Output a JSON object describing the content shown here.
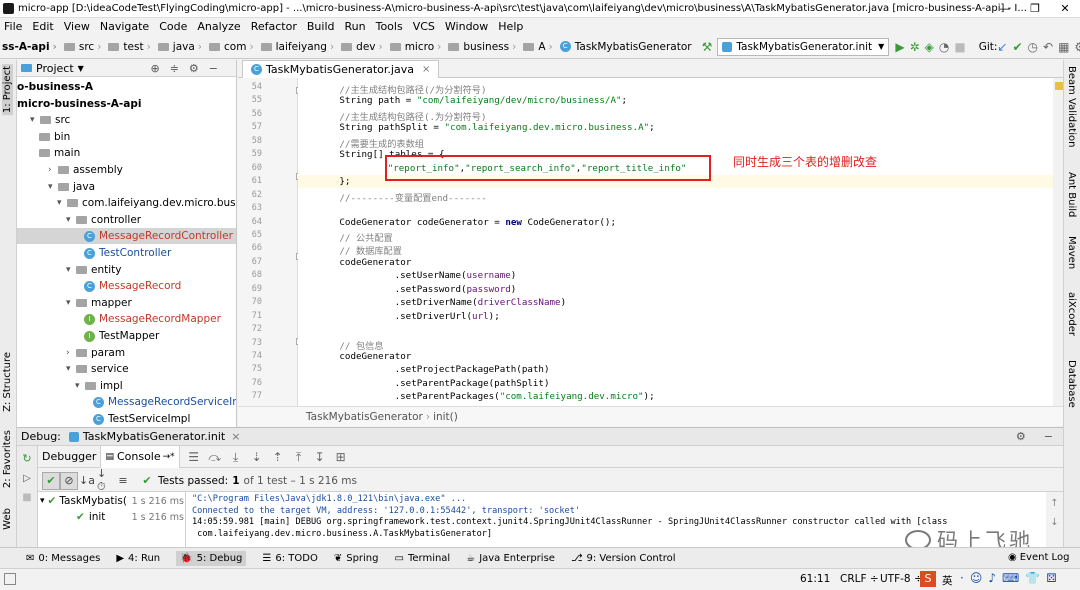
{
  "title_bar": {
    "text": "micro-app [D:\\ideaCodeTest\\FlyingCoding\\micro-app] - ...\\micro-business-A\\micro-business-A-api\\src\\test\\java\\com\\laifeiyang\\dev\\micro\\business\\A\\TaskMybatisGenerator.java [micro-business-A-api] - I..."
  },
  "menu": [
    "File",
    "Edit",
    "View",
    "Navigate",
    "Code",
    "Analyze",
    "Refactor",
    "Build",
    "Run",
    "Tools",
    "VCS",
    "Window",
    "Help"
  ],
  "breadcrumbs": [
    "ss-A-api",
    "src",
    "test",
    "java",
    "com",
    "laifeiyang",
    "dev",
    "micro",
    "business",
    "A",
    "TaskMybatisGenerator"
  ],
  "run_config": "TaskMybatisGenerator.init",
  "git_label": "Git:",
  "project_panel": {
    "title": "Project"
  },
  "tree": [
    {
      "label": "o-business-A",
      "indent": 0,
      "kind": "bold"
    },
    {
      "label": "micro-business-A-api",
      "indent": 0,
      "kind": "bold"
    },
    {
      "label": "src",
      "indent": 1,
      "kind": "folder",
      "arrow": "open"
    },
    {
      "label": "bin",
      "indent": 2,
      "kind": "folder"
    },
    {
      "label": "main",
      "indent": 2,
      "kind": "folder"
    },
    {
      "label": "assembly",
      "indent": 3,
      "kind": "folder",
      "arrow": "closed"
    },
    {
      "label": "java",
      "indent": 3,
      "kind": "folder",
      "arrow": "open"
    },
    {
      "label": "com.laifeiyang.dev.micro.business.A",
      "indent": 4,
      "kind": "folder",
      "arrow": "open"
    },
    {
      "label": "controller",
      "indent": 5,
      "kind": "folder",
      "arrow": "open"
    },
    {
      "label": "MessageRecordController",
      "indent": 7,
      "kind": "class-red"
    },
    {
      "label": "TestController",
      "indent": 7,
      "kind": "class-blue"
    },
    {
      "label": "entity",
      "indent": 5,
      "kind": "folder",
      "arrow": "open"
    },
    {
      "label": "MessageRecord",
      "indent": 7,
      "kind": "class-red"
    },
    {
      "label": "mapper",
      "indent": 5,
      "kind": "folder",
      "arrow": "open"
    },
    {
      "label": "MessageRecordMapper",
      "indent": 7,
      "kind": "intf-red"
    },
    {
      "label": "TestMapper",
      "indent": 7,
      "kind": "intf"
    },
    {
      "label": "param",
      "indent": 5,
      "kind": "folder",
      "arrow": "closed"
    },
    {
      "label": "service",
      "indent": 5,
      "kind": "folder",
      "arrow": "open"
    },
    {
      "label": "impl",
      "indent": 6,
      "kind": "folder",
      "arrow": "open"
    },
    {
      "label": "MessageRecordServiceIm",
      "indent": 8,
      "kind": "class-blue"
    },
    {
      "label": "TestServiceImpl",
      "indent": 8,
      "kind": "class"
    }
  ],
  "editor_tab": "TaskMybatisGenerator.java",
  "code_lines": [
    {
      "n": "54",
      "html": "<span class=\"cm\">//主生成结构包路径(/为分割符号)</span>",
      "ind": 6
    },
    {
      "n": "55",
      "html": "String path = <span class=\"str\">\"com/laifeiyang/dev/micro/business/A\"</span>;",
      "ind": 6
    },
    {
      "n": "56",
      "html": "<span class=\"cm\">//主生成结构包路径(.为分割符号)</span>",
      "ind": 6
    },
    {
      "n": "57",
      "html": "String pathSplit = <span class=\"str\">\"com.laifeiyang.dev.micro.business.A\"</span>;",
      "ind": 6
    },
    {
      "n": "58",
      "html": "<span class=\"cm\">//需要生成的表数组</span>",
      "ind": 6
    },
    {
      "n": "59",
      "html": "String[] tables = {",
      "ind": 6
    },
    {
      "n": "60",
      "html": "<span class=\"str\">\"report_info\"</span>,<span class=\"str\">\"report_search_info\"</span>,<span class=\"str\">\"report_title_info\"</span>",
      "ind": 13
    },
    {
      "n": "61",
      "html": "};",
      "ind": 6
    },
    {
      "n": "62",
      "html": "<span class=\"cm\">//--------变量配置end-------</span>",
      "ind": 6
    },
    {
      "n": "63",
      "html": "",
      "ind": 6
    },
    {
      "n": "64",
      "html": "CodeGenerator codeGenerator = <span class=\"kw\">new</span> CodeGenerator();",
      "ind": 6
    },
    {
      "n": "65",
      "html": "<span class=\"cm\">// 公共配置</span>",
      "ind": 6
    },
    {
      "n": "66",
      "html": "<span class=\"cm\">// 数据库配置</span>",
      "ind": 6
    },
    {
      "n": "67",
      "html": "codeGenerator",
      "ind": 6
    },
    {
      "n": "68",
      "html": ".setUserName(<span class=\"prm\">username</span>)",
      "ind": 14
    },
    {
      "n": "69",
      "html": ".setPassword(<span class=\"prm\">password</span>)",
      "ind": 14
    },
    {
      "n": "70",
      "html": ".setDriverName(<span class=\"prm\">driverClassName</span>)",
      "ind": 14
    },
    {
      "n": "71",
      "html": ".setDriverUrl(<span class=\"prm\">url</span>);",
      "ind": 14
    },
    {
      "n": "72",
      "html": "",
      "ind": 6
    },
    {
      "n": "73",
      "html": "<span class=\"cm\">// 包信息</span>",
      "ind": 6
    },
    {
      "n": "74",
      "html": "codeGenerator",
      "ind": 6
    },
    {
      "n": "75",
      "html": ".setProjectPackagePath(path)",
      "ind": 14
    },
    {
      "n": "76",
      "html": ".setParentPackage(pathSplit)",
      "ind": 14
    },
    {
      "n": "77",
      "html": ".setParentPackages(<span class=\"str\">\"com.laifeiyang.dev.micro\"</span>);",
      "ind": 14
    }
  ],
  "annotation": "同时生成三个表的增删改查",
  "editor_breadcrumb": [
    "TaskMybatisGenerator",
    "init()"
  ],
  "debug": {
    "label": "Debug:",
    "config": "TaskMybatisGenerator.init",
    "tabs": [
      "Debugger",
      "Console"
    ],
    "tests_passed": "Tests passed:",
    "tests_count": "1",
    "tests_detail": "of 1 test – 1 s 216 ms"
  },
  "test_tree": [
    {
      "label": "TaskMybatis(",
      "time": "1 s 216 ms"
    },
    {
      "label": "init",
      "time": "1 s 216 ms"
    }
  ],
  "console_lines": [
    "\"C:\\Program Files\\Java\\jdk1.8.0_121\\bin\\java.exe\" ...",
    "Connected to the target VM, address: '127.0.0.1:55442', transport: 'socket'",
    "14:05:59.981 [main] DEBUG org.springframework.test.context.junit4.SpringJUnit4ClassRunner - SpringJUnit4ClassRunner constructor called with [class",
    " com.laifeiyang.dev.micro.business.A.TaskMybatisGenerator]"
  ],
  "console_colors": [
    "#1a4ea0",
    "#1a4ea0",
    "#000000",
    "#000000"
  ],
  "left_stripe": [
    "1: Project",
    "Z: Structure",
    "2: Favorites",
    "Web"
  ],
  "right_stripe": [
    "Beam Validation",
    "Ant Build",
    "Maven",
    "aiXcoder",
    "Database"
  ],
  "tool_windows": [
    {
      "label": "0: Messages",
      "icon": "✉"
    },
    {
      "label": "4: Run",
      "icon": "▶"
    },
    {
      "label": "5: Debug",
      "icon": "🐞"
    },
    {
      "label": "6: TODO",
      "icon": "☰"
    },
    {
      "label": "Spring",
      "icon": "❦"
    },
    {
      "label": "Terminal",
      "icon": "▭"
    },
    {
      "label": "Java Enterprise",
      "icon": "☕"
    },
    {
      "label": "9: Version Control",
      "icon": "⎇"
    }
  ],
  "event_log": "Event Log",
  "status": {
    "position": "61:11",
    "line_sep": "CRLF ÷",
    "encoding": "UTF-8 ÷",
    "ime": "英"
  },
  "watermark": "码上飞驰",
  "colors": {
    "annotation": "#e02020",
    "test_pass": "#3a9b3a",
    "accent_tab": "#4aa0d8"
  }
}
